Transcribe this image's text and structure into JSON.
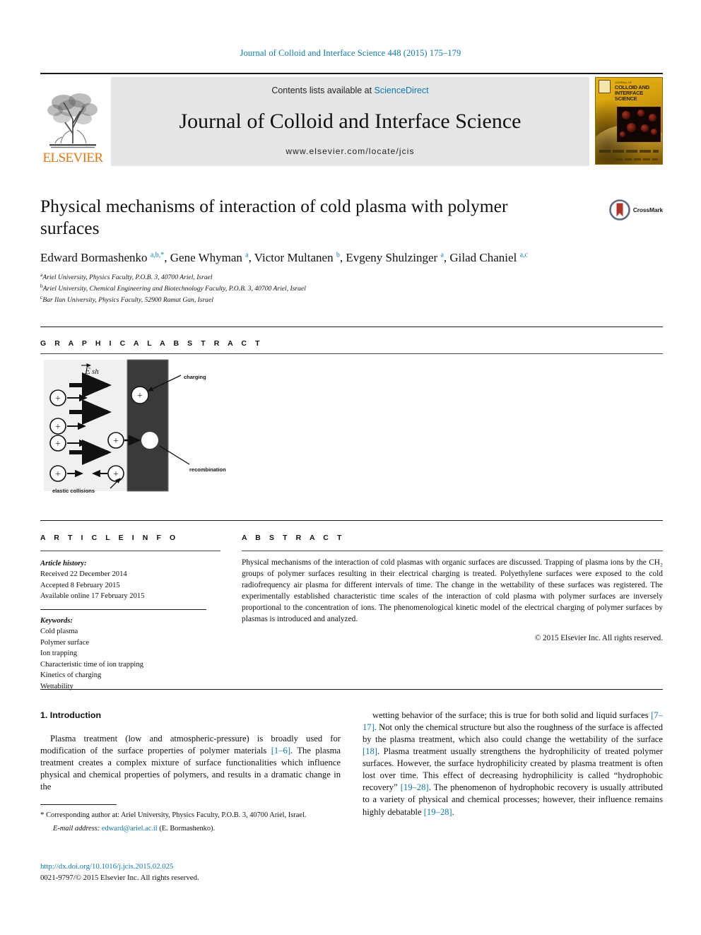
{
  "running_head": "Journal of Colloid and Interface Science 448 (2015) 175–179",
  "masthead": {
    "publisher_wordmark": "ELSEVIER",
    "contents_prefix": "Contents lists available at ",
    "sciencedirect": "ScienceDirect",
    "journal_title": "Journal of Colloid and Interface Science",
    "journal_url": "www.elsevier.com/locate/jcis",
    "cover_title_line1": "COLLOID AND",
    "cover_title_line2": "INTERFACE",
    "cover_title_line3": "SCIENCE",
    "cover_title_small": "JOURNAL OF",
    "accent_blue": "#0b7ab0",
    "elsevier_orange": "#e87511",
    "banner_gray": "#e6e6e6",
    "cover_gold": "#d8a30e"
  },
  "article": {
    "title": "Physical mechanisms of interaction of cold plasma with polymer surfaces",
    "crossmark_label": "CrossMark",
    "authors_html": "Edward Bormashenko <sup>a,b,*</sup>, Gene Whyman <sup>a</sup>, Victor Multanen <sup>b</sup>, Evgeny Shulzinger <sup>a</sup>, Gilad Chaniel <sup>a,c</sup>",
    "affiliations": [
      {
        "mark": "a",
        "text": "Ariel University, Physics Faculty, P.O.B. 3, 40700 Ariel, Israel"
      },
      {
        "mark": "b",
        "text": "Ariel University, Chemical Engineering and Biotechnology Faculty, P.O.B. 3, 40700 Ariel, Israel"
      },
      {
        "mark": "c",
        "text": "Bar Ilan University, Physics Faculty, 52900 Ramat Gan, Israel"
      }
    ]
  },
  "graphical_abstract": {
    "heading": "G R A P H I C A L   A B S T R A C T",
    "field_label": "E sh",
    "label_charging": "charging",
    "label_recombination": "recombination",
    "label_elastic": "elastic collisions",
    "ion_symbol": "+"
  },
  "article_info": {
    "heading": "A R T I C L E   I N F O",
    "history_label": "Article history:",
    "history": [
      "Received 22 December 2014",
      "Accepted 8 February 2015",
      "Available online 17 February 2015"
    ],
    "keywords_label": "Keywords:",
    "keywords": [
      "Cold plasma",
      "Polymer surface",
      "Ion trapping",
      "Characteristic time of ion trapping",
      "Kinetics of charging",
      "Wettability"
    ]
  },
  "abstract": {
    "heading": "A B S T R A C T",
    "text": "Physical mechanisms of the interaction of cold plasmas with organic surfaces are discussed. Trapping of plasma ions by the CH₂ groups of polymer surfaces resulting in their electrical charging is treated. Polyethylene surfaces were exposed to the cold radiofrequency air plasma for different intervals of time. The change in the wettability of these surfaces was registered. The experimentally established characteristic time scales of the interaction of cold plasma with polymer surfaces are inversely proportional to the concentration of ions. The phenomenological kinetic model of the electrical charging of polymer surfaces by plasmas is introduced and analyzed.",
    "copyright": "© 2015 Elsevier Inc. All rights reserved."
  },
  "body": {
    "section_heading": "1. Introduction",
    "left_paragraph_html": "Plasma treatment (low and atmospheric-pressure) is broadly used for modification of the surface properties of polymer materials <span class=\"ref\">[1–6]</span>. The plasma treatment creates a complex mixture of surface functionalities which influence physical and chemical properties of polymers, and results in a dramatic change in the",
    "right_paragraph_html": "wetting behavior of the surface; this is true for both solid and liquid surfaces <span class=\"ref\">[7–17]</span>. Not only the chemical structure but also the roughness of the surface is affected by the plasma treatment, which also could change the wettability of the surface <span class=\"ref\">[18]</span>. Plasma treatment usually strengthens the hydrophilicity of treated polymer surfaces. However, the surface hydrophilicity created by plasma treatment is often lost over time. This effect of decreasing hydrophilicity is called “hydrophobic recovery” <span class=\"ref\">[19–28]</span>. The phenomenon of hydrophobic recovery is usually attributed to a variety of physical and chemical processes; however, their influence remains highly debatable <span class=\"ref\">[19–28]</span>."
  },
  "footnotes": {
    "corresponding_html": "<span style=\"font-size:11px\">*</span> Corresponding author at: Ariel University, Physics Faculty, P.O.B. 3, 40700 Ariel, Israel.",
    "email_label": "E-mail address:",
    "email": "edward@ariel.ac.il",
    "email_owner": "(E. Bormashenko).",
    "doi": "http://dx.doi.org/10.1016/j.jcis.2015.02.025",
    "issn_line": "0021-9797/© 2015 Elsevier Inc. All rights reserved."
  }
}
